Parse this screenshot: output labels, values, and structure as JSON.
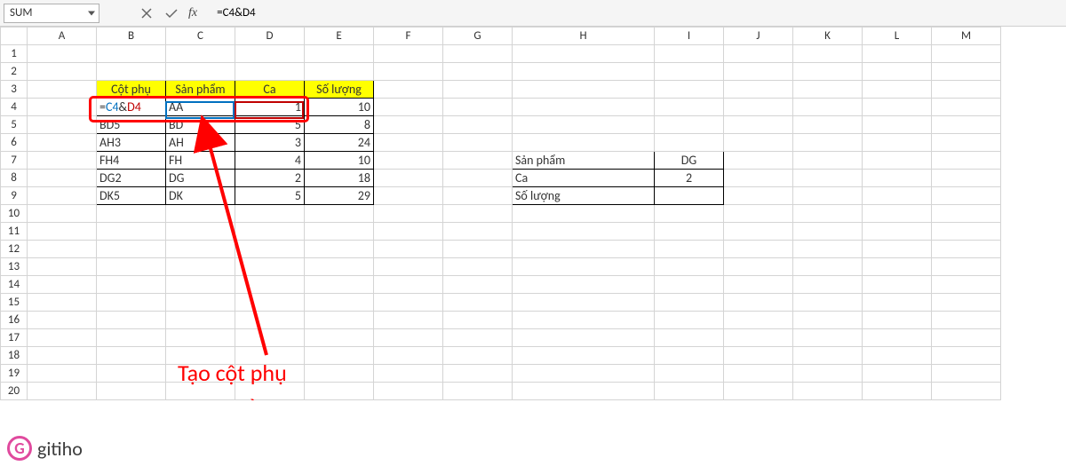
{
  "name_box": "SUM",
  "fx_label": "fx",
  "formula": "=C4&D4",
  "cols": [
    "A",
    "B",
    "C",
    "D",
    "E",
    "F",
    "G",
    "H",
    "I",
    "J",
    "K",
    "L",
    "M"
  ],
  "rows": [
    "1",
    "2",
    "3",
    "4",
    "5",
    "6",
    "7",
    "8",
    "9",
    "10",
    "11",
    "12",
    "13",
    "14",
    "15",
    "16",
    "17",
    "18",
    "19",
    "20"
  ],
  "table_main": {
    "headers": [
      "Cột phụ",
      "Sản phẩm",
      "Ca",
      "Số lượng"
    ],
    "rows": [
      {
        "formula_eq": "=",
        "ref1": "C4",
        "amp": "&",
        "ref2": "D4",
        "c": "AA",
        "d": "1",
        "e": "10"
      },
      {
        "b": "BD5",
        "c": "BD",
        "d": "5",
        "e": "8"
      },
      {
        "b": "AH3",
        "c": "AH",
        "d": "3",
        "e": "24"
      },
      {
        "b": "FH4",
        "c": "FH",
        "d": "4",
        "e": "10"
      },
      {
        "b": "DG2",
        "c": "DG",
        "d": "2",
        "e": "18"
      },
      {
        "b": "DK5",
        "c": "DK",
        "d": "5",
        "e": "29"
      }
    ]
  },
  "lookup": {
    "rows": [
      {
        "label": "Sản phẩm",
        "value": "DG"
      },
      {
        "label": "Ca",
        "value": "2"
      },
      {
        "label": "Số lượng",
        "value": ""
      }
    ]
  },
  "annotation": {
    "line1": "Tạo cột phụ",
    "line2": "Ghép điều kiện"
  },
  "brand": "gitiho"
}
